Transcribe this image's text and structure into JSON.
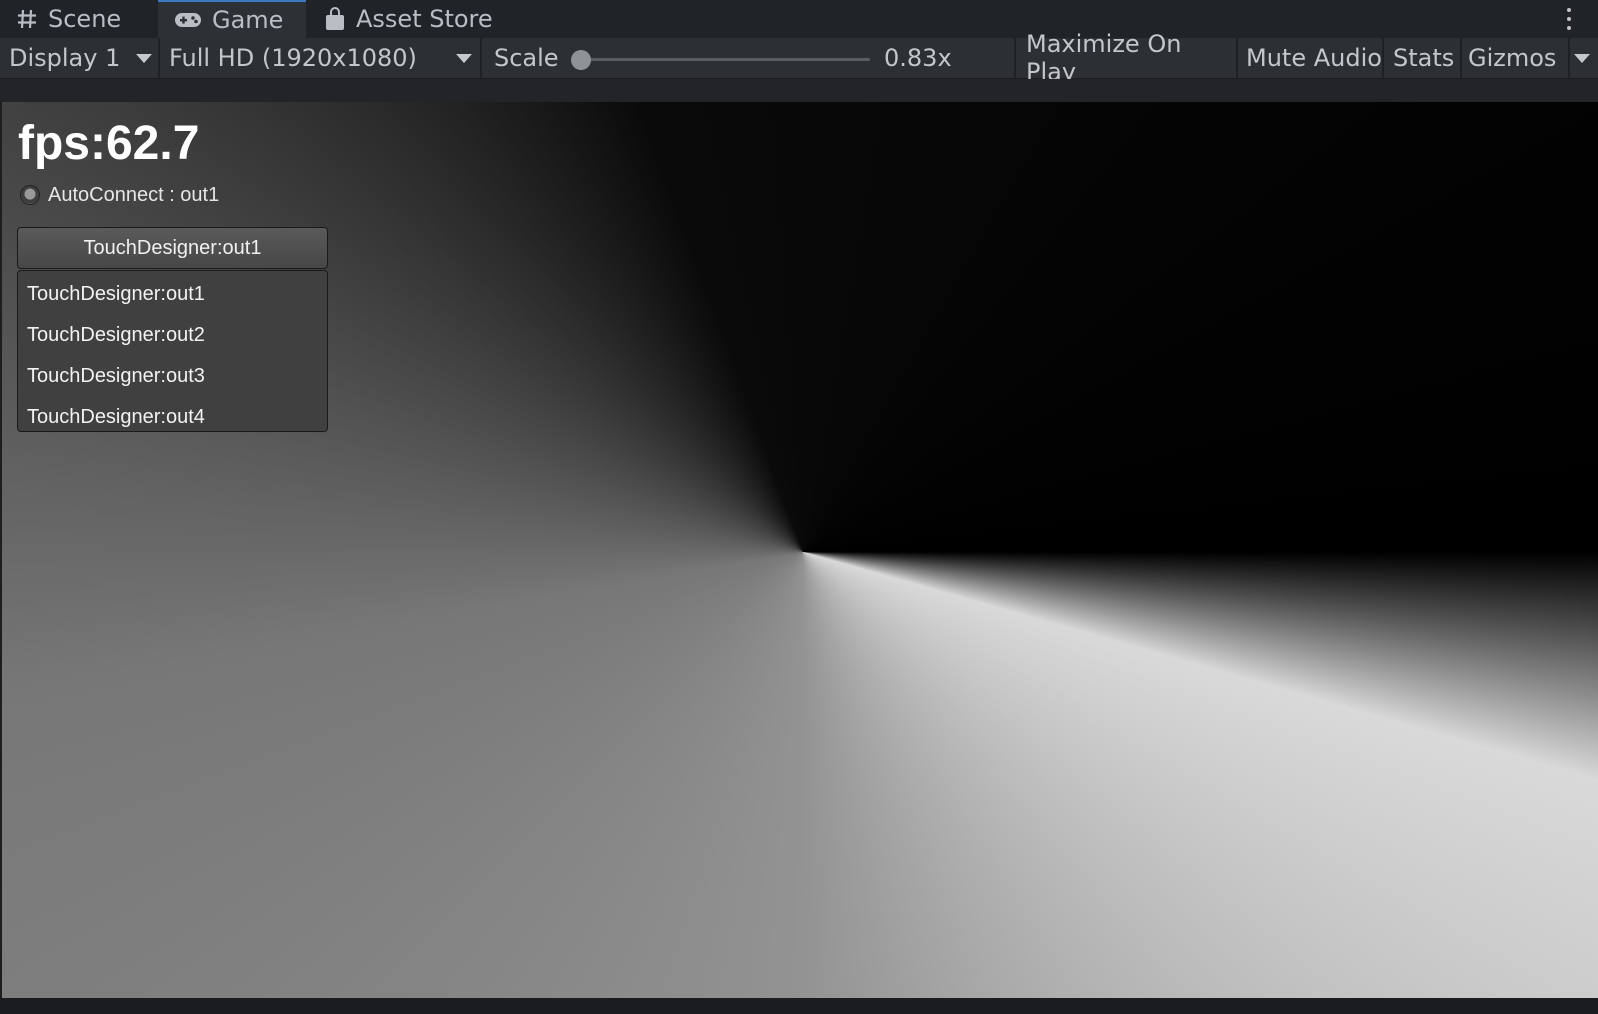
{
  "tabs": {
    "scene": {
      "label": "Scene",
      "icon": "grid-hash-icon"
    },
    "game": {
      "label": "Game",
      "icon": "gamepad-icon",
      "active": true
    },
    "asset_store": {
      "label": "Asset Store",
      "icon": "shopping-bag-icon"
    }
  },
  "toolbar": {
    "display_label": "Display 1",
    "resolution_label": "Full HD (1920x1080)",
    "scale_label": "Scale",
    "scale_value": "0.83x",
    "maximize_label": "Maximize On Play",
    "mute_label": "Mute Audio",
    "stats_label": "Stats",
    "gizmos_label": "Gizmos"
  },
  "game_view": {
    "fps_text": "fps:62.7",
    "autoconnect_text": "AutoConnect : out1",
    "dropdown_selected": "TouchDesigner:out1",
    "dropdown_options": [
      "TouchDesigner:out1",
      "TouchDesigner:out2",
      "TouchDesigner:out3",
      "TouchDesigner:out4"
    ]
  },
  "colors": {
    "tab_bar": "#202327",
    "toolbar": "#2c3035",
    "active_tab_accent": "#3a79bb"
  }
}
